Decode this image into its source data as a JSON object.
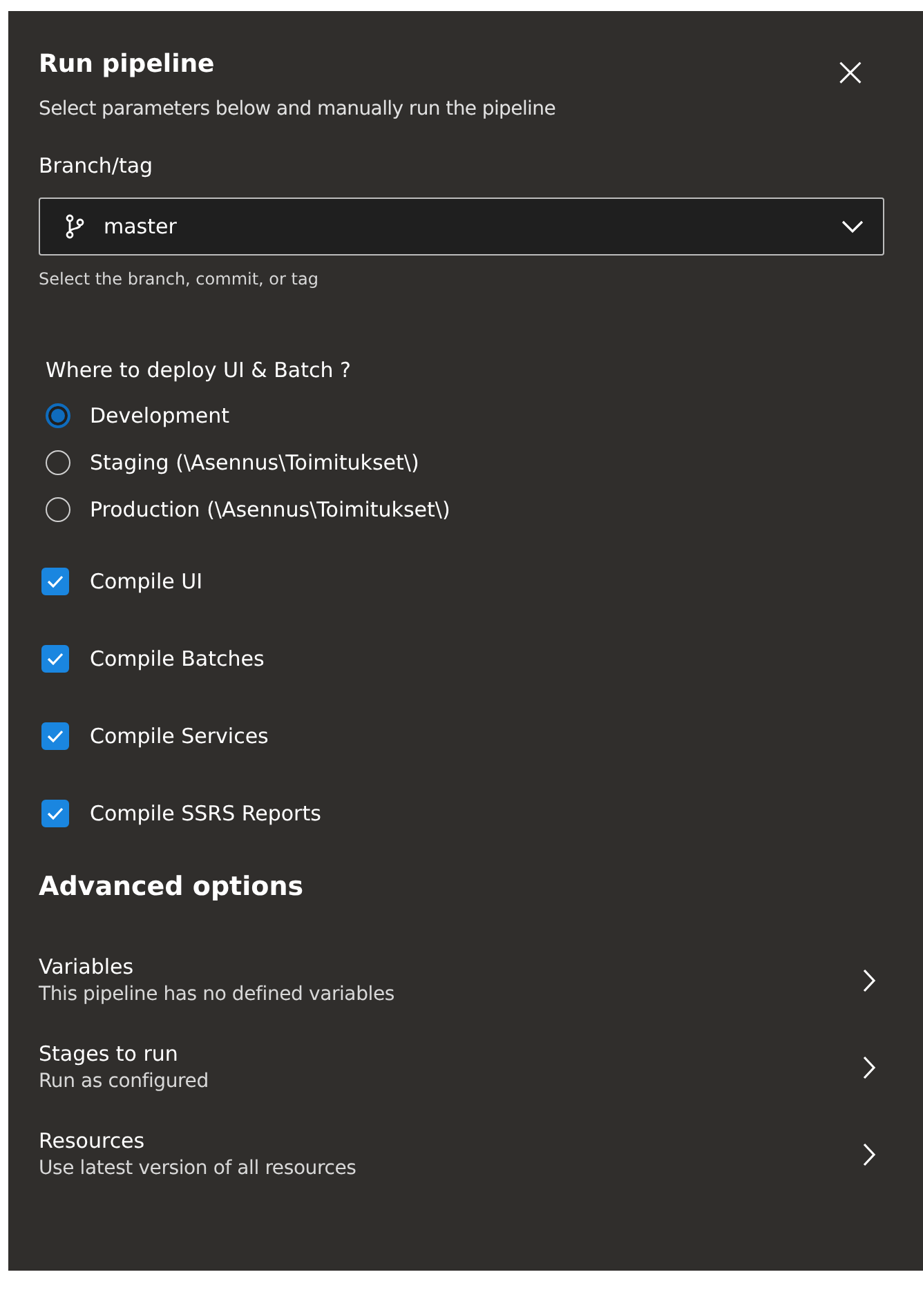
{
  "dialog": {
    "title": "Run pipeline",
    "subtitle": "Select parameters below and manually run the pipeline",
    "close": "×"
  },
  "branch": {
    "label": "Branch/tag",
    "value": "master",
    "help": "Select the branch, commit, or tag"
  },
  "deploy": {
    "question": "Where to deploy UI & Batch ?",
    "options": [
      {
        "label": "Development",
        "selected": true
      },
      {
        "label": "Staging (\\Asennus\\Toimitukset\\)",
        "selected": false
      },
      {
        "label": "Production (\\Asennus\\Toimitukset\\)",
        "selected": false
      }
    ]
  },
  "checkboxes": [
    {
      "label": "Compile UI",
      "checked": true
    },
    {
      "label": "Compile Batches",
      "checked": true
    },
    {
      "label": "Compile Services",
      "checked": true
    },
    {
      "label": "Compile SSRS Reports",
      "checked": true
    }
  ],
  "advanced": {
    "heading": "Advanced options",
    "items": [
      {
        "title": "Variables",
        "description": "This pipeline has no defined variables"
      },
      {
        "title": "Stages to run",
        "description": "Run as configured"
      },
      {
        "title": "Resources",
        "description": "Use latest version of all resources"
      }
    ]
  }
}
